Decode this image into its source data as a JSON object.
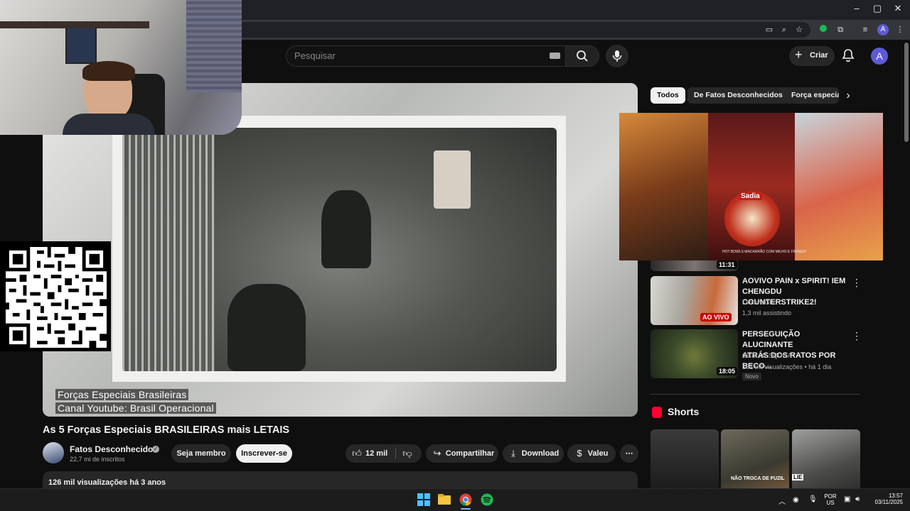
{
  "browser": {
    "window_controls": [
      "–",
      "▢",
      "✕"
    ],
    "toolbar_icons": [
      "cast-icon",
      "zoom-icon",
      "bookmark-star-icon",
      "extension-green-icon",
      "extensions-puzzle-icon",
      "media-queue-icon",
      "profile-icon",
      "menu-dots-icon"
    ],
    "profile_initial": "A"
  },
  "header": {
    "search_placeholder": "Pesquisar",
    "create_label": "Criar",
    "avatar_initial": "A"
  },
  "player": {
    "caption_line1": "Forças Especiais Brasileiras",
    "caption_line2": "Canal Youtube: Brasil Operacional"
  },
  "video": {
    "title": "As 5 Forças Especiais BRASILEIRAS mais LETAIS",
    "channel": "Fatos Desconhecidos",
    "subscribers": "22,7 mi de inscritos",
    "member_label": "Seja membro",
    "subscribe_label": "Inscrever-se",
    "likes": "12 mil",
    "share_label": "Compartilhar",
    "download_label": "Download",
    "thanks_label": "Valeu",
    "description_meta": "126 mil visualizações  há 3 anos"
  },
  "chips": [
    "Todos",
    "De Fatos Desconhecidos",
    "Força especial"
  ],
  "recommendations": [
    {
      "title_line1": "",
      "title_line2": "",
      "channel": "",
      "meta": "",
      "duration": "11:31",
      "live": false
    },
    {
      "title_line1": "AOVIVO PAIN x SPIRIT! IEM",
      "title_line2": "CHENGDU COUNTERSTRIKE2!",
      "channel": "LiminhaG0d",
      "meta": "1,3 mil assistindo",
      "duration": "AO VIVO",
      "live": true
    },
    {
      "title_line1": "PERSEGUIÇÃO ALUCINANTE",
      "title_line2": "ATRÁS DOS RATOS POR BECO...",
      "channel": "GCM MESQUITA",
      "meta": "161 mil visualizações • há 1 dia",
      "duration": "18:05",
      "badge": "Novo",
      "live": false
    }
  ],
  "shorts": {
    "title": "Shorts",
    "items": [
      {
        "overlay_text": ""
      },
      {
        "overlay_text": "NÃO TROCA DE FUZIL"
      },
      {
        "overlay_text": "LIE"
      }
    ]
  },
  "ad": {
    "product_text": "Sadia",
    "caption": "HOT BOWLS MACARRÃO COM MILHO E FRANGO"
  },
  "taskbar": {
    "apps": [
      "windows-start-icon",
      "file-explorer-icon",
      "chrome-icon",
      "spotify-icon"
    ],
    "lang_line1": "POR",
    "lang_line2": "US",
    "time": "13:57",
    "date": "03/11/2025"
  },
  "colors": {
    "background": "#0f0f0f",
    "surface": "#272727",
    "live_red": "#cc0000",
    "accent_blue": "#5b5bd6",
    "shorts_red": "#ff0033"
  }
}
